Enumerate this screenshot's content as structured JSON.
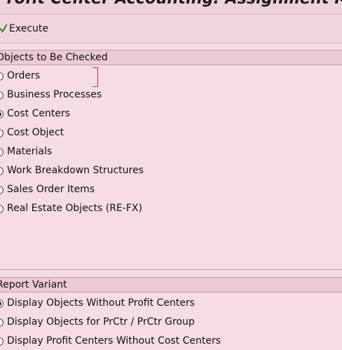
{
  "window": {
    "title": "Profit Center Accounting: Assignment Monitor"
  },
  "toolbar": {
    "execute_label": "Execute",
    "execute_icon": "execute-check-icon"
  },
  "objects_section": {
    "header": "Objects to Be Checked",
    "options": [
      {
        "label": "Orders",
        "selected": false
      },
      {
        "label": "Business Processes",
        "selected": false
      },
      {
        "label": "Cost Centers",
        "selected": true
      },
      {
        "label": "Cost Object",
        "selected": false
      },
      {
        "label": "Materials",
        "selected": false
      },
      {
        "label": "Work Breakdown Structures",
        "selected": false
      },
      {
        "label": "Sales Order Items",
        "selected": false
      },
      {
        "label": "Real Estate Objects (RE-FX)",
        "selected": false
      }
    ]
  },
  "report_section": {
    "header": "Report Variant",
    "options": [
      {
        "label": "Display Objects Without Profit Centers",
        "selected": true
      },
      {
        "label": "Display Objects for PrCtr / PrCtr Group",
        "selected": false
      },
      {
        "label": "Display Profit Centers Without Cost Centers",
        "selected": false
      }
    ]
  },
  "colors": {
    "background": "#f5dde3",
    "section_header": "#eccad3",
    "focus": "#c0334f"
  }
}
